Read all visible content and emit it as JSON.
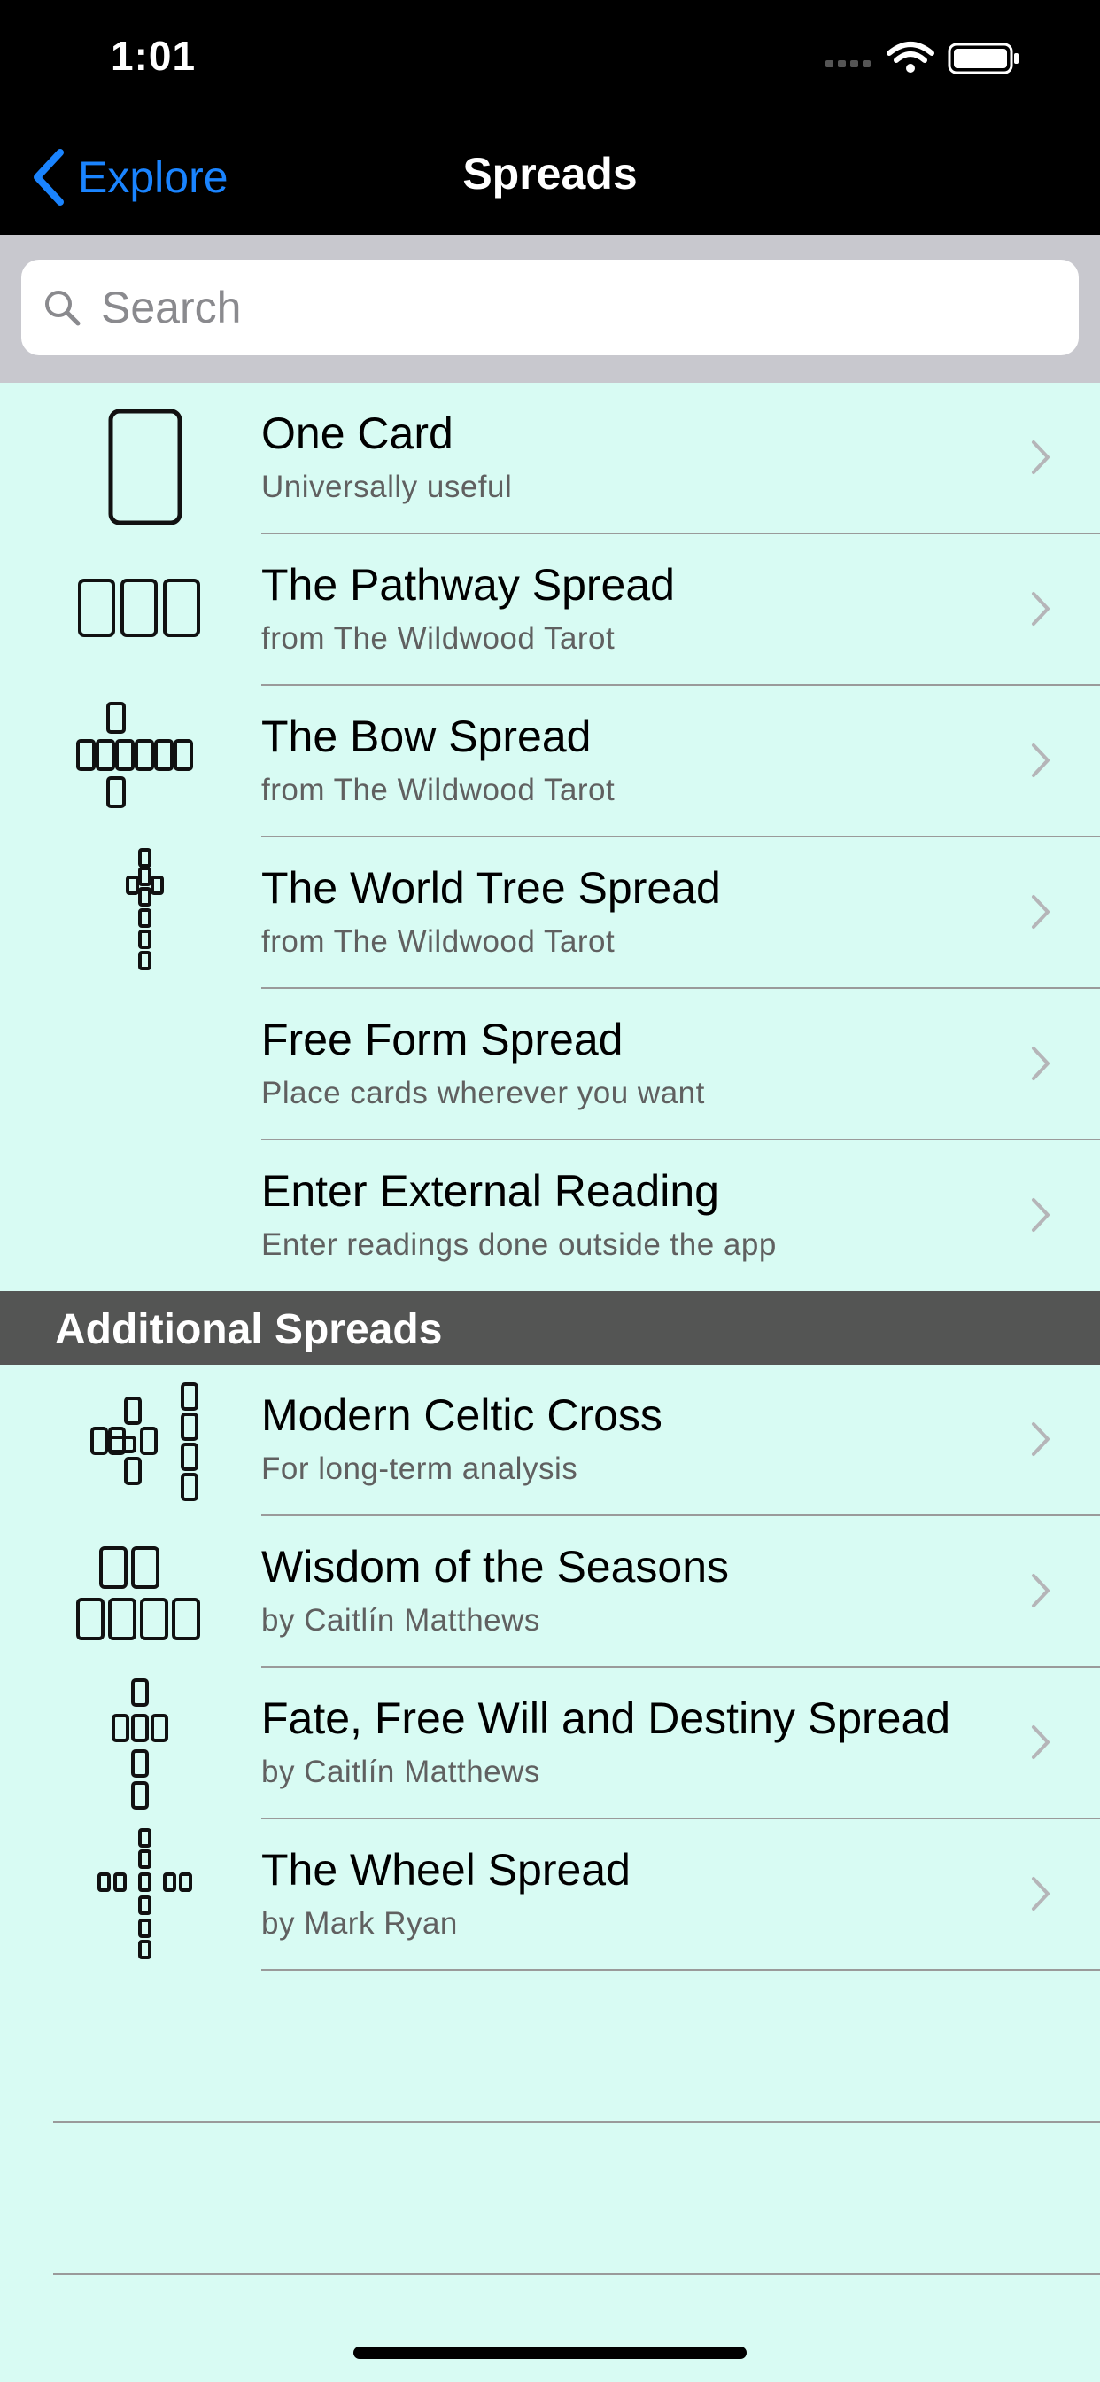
{
  "status_bar": {
    "time": "1:01"
  },
  "nav": {
    "back_label": "Explore",
    "title": "Spreads"
  },
  "search": {
    "placeholder": "Search",
    "value": ""
  },
  "spreads": [
    {
      "title": "One Card",
      "subtitle": "Universally useful",
      "icon": "one-card-spread-icon"
    },
    {
      "title": "The Pathway Spread",
      "subtitle": "from The Wildwood Tarot",
      "icon": "pathway-spread-icon"
    },
    {
      "title": "The Bow Spread",
      "subtitle": "from The Wildwood Tarot",
      "icon": "bow-spread-icon"
    },
    {
      "title": "The World Tree Spread",
      "subtitle": "from The Wildwood Tarot",
      "icon": "world-tree-spread-icon"
    },
    {
      "title": "Free Form Spread",
      "subtitle": "Place cards wherever you want",
      "icon": ""
    },
    {
      "title": "Enter External Reading",
      "subtitle": "Enter readings done outside the app",
      "icon": ""
    }
  ],
  "additional_section": {
    "title": "Additional Spreads"
  },
  "additional_spreads": [
    {
      "title": "Modern Celtic Cross",
      "subtitle": "For long-term analysis",
      "icon": "celtic-cross-spread-icon"
    },
    {
      "title": "Wisdom of the Seasons",
      "subtitle": "by Caitlín Matthews",
      "icon": "seasons-spread-icon"
    },
    {
      "title": "Fate, Free Will and Destiny Spread",
      "subtitle": "by Caitlín Matthews",
      "icon": "fate-spread-icon"
    },
    {
      "title": "The Wheel Spread",
      "subtitle": "by Mark Ryan",
      "icon": "wheel-spread-icon"
    }
  ],
  "colors": {
    "accent": "#1a84ff",
    "list_background": "#d8fbf3",
    "section_header": "#545554"
  }
}
